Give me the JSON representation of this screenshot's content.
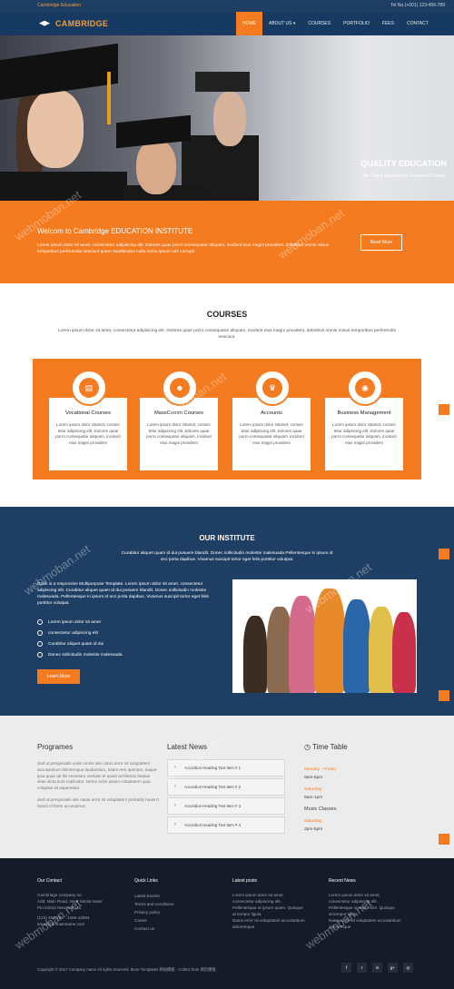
{
  "topbar": {
    "left": "Cambridge Education",
    "right": "Tel No.(+001) 123-456-789"
  },
  "logo": {
    "text": "CAMBRIDGE"
  },
  "menu": [
    "HOME",
    "ABOUT US ▾",
    "COURSES",
    "PORTFOLIO",
    "FEES",
    "CONTACT"
  ],
  "hero": {
    "title": "QUALITY EDUCATION",
    "subtitle": "We Teach Students for Sucessful Fututre"
  },
  "welcome": {
    "title": "Welcom to Cambridge EDUCATION INSTITUTE",
    "text": "Lorem ipsum dolor sit amet, consectetur adipisicing elit. Dolores quae porro consequatur aliquam, incidunt eius magni provident, doloribus omnis minus temporibus perferendis nesciunt quam repellendus nulla nemo ipsum odit corrupti.",
    "button": "Read More"
  },
  "courses": {
    "title": "COURSES",
    "text": "Lorem ipsum dolor sit amet, consectetur adipisicing elit. Dolores quae porro consequatur aliquam, incidunt eius magni provident, doloribus omnis minus temporibus perferendis nesciunt.",
    "cards": [
      {
        "icon": "book-icon",
        "glyph": "▤",
        "title": "Vocational Courses",
        "text": "Lorem ipsum dolor sitamet, consec tetur adipiscing elit. Dolores quae porro consequatur aliquam, incidunt eius magni provident"
      },
      {
        "icon": "users-icon",
        "glyph": "☻",
        "title": "MassComm Courses",
        "text": "Lorem ipsum dolor sitamet, consec tetur adipiscing elit. Dolores quae porro consequatur aliquam, incidunt eius magni provident"
      },
      {
        "icon": "trophy-icon",
        "glyph": "♛",
        "title": "Accounts",
        "text": "Lorem ipsum dolor sitamet, consec tetur adipiscing elit. Dolores quae porro consequatur aliquam, incidunt eius magni provident"
      },
      {
        "icon": "globe-icon",
        "glyph": "◉",
        "title": "Business Management",
        "text": "Lorem ipsum dolor sitamet, consec tetur adipiscing elit. Dolores quae porro consequatur aliquam, incidunt eius magni provident"
      }
    ]
  },
  "institute": {
    "title": "OUR INSTITUTE",
    "subtitle": "Curabitur aliquet quam id dui posuere blandit. Donec sollicitudin molestie malesuada Pellentesque in ipsum id orci porta dapibus. Vivamus suscipit tortor eget felis porttitor volutpat.",
    "text": "Grids is a responsive Multipurpose Template. Lorem ipsum dolor sit amet, consectetur adipiscing elit. Curabitur aliquet quam id dui posuere blandit. Donec sollicitudin molestie malesuada. Pellentesque in ipsum id orci porta dapibus. Vivamus suscipit tortor eget felis porttitor volutpat.",
    "list": [
      "Lorem ipsum dolor sit amet",
      "consectetur adipiscing elit",
      "Curabitur aliquet quam id dui",
      "Donec sollicitudin molestie malesuada."
    ],
    "button": "Learn More"
  },
  "programes": {
    "title": "Programes",
    "p1": "Sed ut perspiciatis unde omnis iste natus error sit voluptatem accusantium doloremque laudantium, totam rem aperiam, eaque ipsa quae ab illo inventore veritatis et quasi architecto beatae vitae dicta sunt explicabo. Nemo enim ipsam voluptatem quia voluptas sit aspernatur.",
    "p2": "Sed ut perspiciatis iste natus error sit voluptatem probably haven't heard of them accusamus."
  },
  "news": {
    "title": "Latest News",
    "items": [
      "Accordion Heading Text Item # 1",
      "Accordion Heading Text Item # 2",
      "Accordion Heading Text Item # 3",
      "Accordion Heading Text Item # 4"
    ]
  },
  "timetable": {
    "title": "Time Table",
    "rows": [
      {
        "day": "Monday - Friday:",
        "time": "9am-5pm"
      },
      {
        "day": "Saturday:",
        "time": "9am-1pm"
      }
    ],
    "music": "Music Classes",
    "music_rows": [
      {
        "day": "Saturday:",
        "time": "2pm-5pm"
      }
    ]
  },
  "footer": {
    "contact": {
      "title": "Our Contact",
      "lines": [
        "Cambridge company inc",
        "Add: Main Road, Near Simila tower",
        "Pin-21542 NewYork US.",
        "(123) 456-789 - 1255-12584",
        "email@domainname.com"
      ]
    },
    "links": {
      "title": "Quick Links",
      "items": [
        "Latest Events",
        "Terms and conditions",
        "Privacy policy",
        "Career",
        "Contact us"
      ]
    },
    "posts": {
      "title": "Latest posts",
      "lines": [
        "Lorem ipsum dolor sit amet,",
        "consectetur adipiscing elit.",
        "Pellentesque ut ipsum quam. Quisque",
        "at tempor ligula",
        "Natus error sit voluptatem accusantium",
        "doloremque"
      ]
    },
    "recent": {
      "title": "Recent News",
      "lines": [
        "Lorem ipsum dolor sit amet,",
        "consectetur adipiscing elit.",
        "Pellentesque ut eros enim. Quisque",
        "at tempor ligula",
        "Natus error sit voluptatem accusantium",
        "doloremque"
      ]
    },
    "copyright": "Copyright © 2017 Company name All rights reserved. More Templates 网站模板 - Collect from 网页模板",
    "social": [
      "f",
      "t",
      "in",
      "g+",
      "◎"
    ]
  },
  "watermark": "webmoban.net",
  "colors": {
    "accent": "#f47b20",
    "navy": "#1f3e63",
    "footer": "#151b29"
  }
}
